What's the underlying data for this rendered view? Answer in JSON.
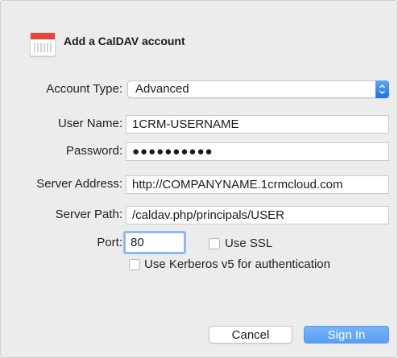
{
  "dialog": {
    "title": "Add a CalDAV account",
    "icon": "calendar-icon"
  },
  "form": {
    "account_type": {
      "label": "Account Type:",
      "value": "Advanced"
    },
    "user_name": {
      "label": "User Name:",
      "value": "1CRM-USERNAME"
    },
    "password": {
      "label": "Password:",
      "value": "●●●●●●●●●●"
    },
    "server_address": {
      "label": "Server Address:",
      "value": "http://COMPANYNAME.1crmcloud.com"
    },
    "server_path": {
      "label": "Server Path:",
      "value": "/caldav.php/principals/USER"
    },
    "port": {
      "label": "Port:",
      "value": "80"
    },
    "use_ssl": {
      "label": "Use SSL",
      "checked": false
    },
    "use_kerberos": {
      "label": "Use Kerberos v5 for authentication",
      "checked": false
    }
  },
  "buttons": {
    "cancel": "Cancel",
    "sign_in": "Sign In"
  },
  "colors": {
    "accent": "#1b73e8",
    "primary_button": "#5aa0f7",
    "focus_ring": "#8fb8ee",
    "calendar_band": "#e2453c",
    "sheet_background": "#ececec"
  }
}
